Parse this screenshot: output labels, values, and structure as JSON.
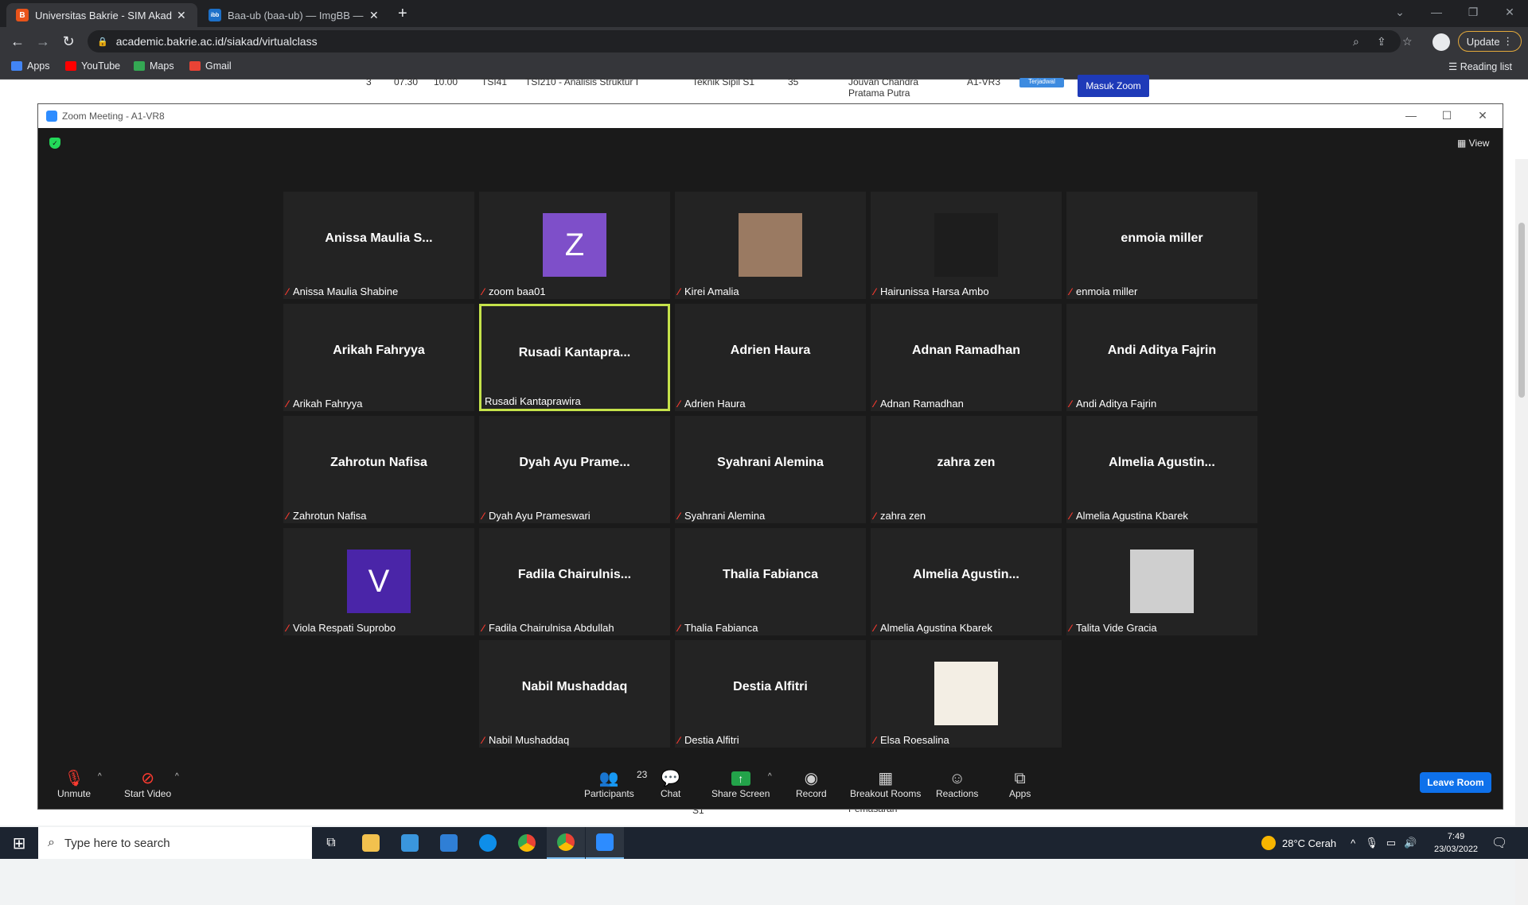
{
  "browser": {
    "tabs": [
      {
        "title": "Universitas Bakrie - SIM Akademik",
        "favicon": "B",
        "favicon_color": "#e8531a",
        "active": true
      },
      {
        "title": "Baa-ub (baa-ub) — ImgBB — Lainnya",
        "favicon": "ibb",
        "favicon_color": "#1d70c8",
        "active": false
      }
    ],
    "url": "academic.bakrie.ac.id/siakad/virtualclass",
    "update_label": "Update",
    "bookmarks": [
      {
        "label": "Apps",
        "color": "#4285f4"
      },
      {
        "label": "YouTube",
        "color": "#ff0000"
      },
      {
        "label": "Maps",
        "color": "#34a853"
      },
      {
        "label": "Gmail",
        "color": "#ea4335"
      }
    ],
    "reading_list": "Reading list"
  },
  "background_page": {
    "row": [
      "3",
      "07.30",
      "10.00",
      "TSI41",
      "TSI210 - Analisis Struktur I",
      "Teknik Sipil S1",
      "35",
      "Jouvan Chandra Pratama Putra",
      "A1-VR3"
    ],
    "status_badge": "Terjadwal",
    "zoom_button": "Masuk Zoom",
    "bottom_text_1": "Pemasaran",
    "bottom_text_2": "S1"
  },
  "zoom": {
    "window_title": "Zoom Meeting - A1-VR8",
    "view_label": "View",
    "participants": [
      {
        "big": "Anissa Maulia S...",
        "label": "Anissa Maulia Shabine",
        "muted": true
      },
      {
        "avatar_letter": "Z",
        "avatar_color": "#7e4fc9",
        "label": "zoom baa01",
        "muted": true
      },
      {
        "photo": "photo",
        "photo_color": "#9a7a62",
        "label": "Kirei Amalia",
        "muted": true
      },
      {
        "photo": "photo",
        "photo_color": "#1d1d1d",
        "label": "Hairunissa Harsa Ambo",
        "muted": true
      },
      {
        "big": "enmoia miller",
        "label": "enmoia miller",
        "muted": true
      },
      {
        "big": "Arikah Fahryya",
        "label": "Arikah Fahryya",
        "muted": true
      },
      {
        "big": "Rusadi  Kantapra...",
        "label": "Rusadi Kantaprawira",
        "muted": false,
        "speaking": true
      },
      {
        "big": "Adrien Haura",
        "label": "Adrien Haura",
        "muted": true
      },
      {
        "big": "Adnan Ramadhan",
        "label": "Adnan Ramadhan",
        "muted": true
      },
      {
        "big": "Andi Aditya Fajrin",
        "label": "Andi Aditya Fajrin",
        "muted": true
      },
      {
        "big": "Zahrotun Nafisa",
        "label": "Zahrotun Nafisa",
        "muted": true
      },
      {
        "big": "Dyah Ayu Prame...",
        "label": "Dyah Ayu Prameswari",
        "muted": true
      },
      {
        "big": "Syahrani Alemina",
        "label": "Syahrani Alemina",
        "muted": true
      },
      {
        "big": "zahra zen",
        "label": "zahra zen",
        "muted": true
      },
      {
        "big": "Almelia  Agustin...",
        "label": "Almelia Agustina Kbarek",
        "muted": true
      },
      {
        "avatar_letter": "V",
        "avatar_color": "#4a25a8",
        "label": "Viola Respati Suprobo",
        "muted": true
      },
      {
        "big": "Fadila  Chairulnis...",
        "label": "Fadila Chairulnisa Abdullah",
        "muted": true
      },
      {
        "big": "Thalia Fabianca",
        "label": "Thalia Fabianca",
        "muted": true
      },
      {
        "big": "Almelia  Agustin...",
        "label": "Almelia Agustina Kbarek",
        "muted": true
      },
      {
        "photo": "photo",
        "photo_color": "#cfcfcf",
        "label": "Talita Vide Gracia",
        "muted": true
      },
      {
        "big": "Nabil Mushaddaq",
        "label": "Nabil Mushaddaq",
        "muted": true
      },
      {
        "big": "Destia Alfitri",
        "label": "Destia Alfitri",
        "muted": true
      },
      {
        "photo": "photo",
        "photo_color": "#f3eee4",
        "label": "Elsa Roesalina",
        "muted": true
      }
    ],
    "toolbar": {
      "unmute": "Unmute",
      "start_video": "Start Video",
      "participants": "Participants",
      "participant_count": "23",
      "chat": "Chat",
      "share_screen": "Share Screen",
      "record": "Record",
      "breakout_rooms": "Breakout Rooms",
      "reactions": "Reactions",
      "apps": "Apps",
      "leave": "Leave Room"
    }
  },
  "taskbar": {
    "search_placeholder": "Type here to search",
    "weather": "28°C  Cerah",
    "time": "7:49",
    "date": "23/03/2022"
  }
}
